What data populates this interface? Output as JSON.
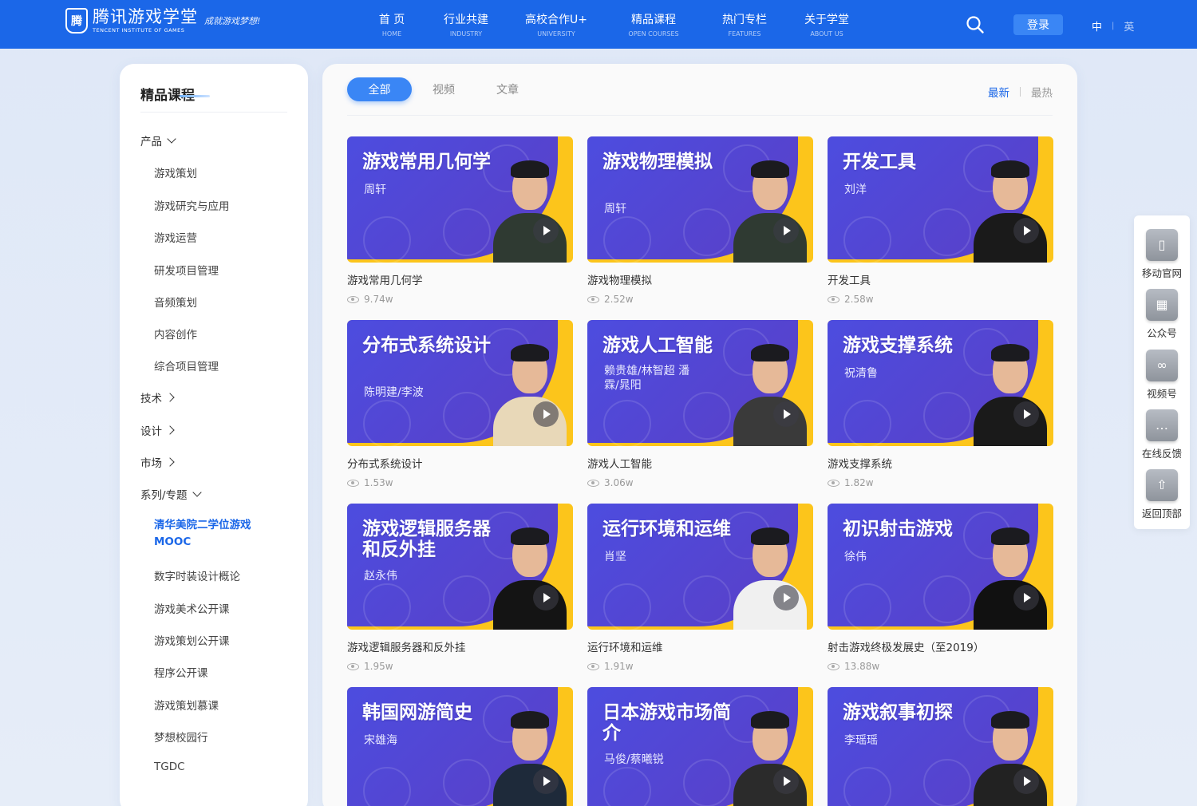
{
  "header": {
    "logo_mark": "腾",
    "logo_cn": "腾讯游戏学堂",
    "logo_en": "TENCENT INSTITUTE OF GAMES",
    "slogan": "成就游戏梦想!",
    "nav": [
      {
        "cn": "首 页",
        "en": "HOME"
      },
      {
        "cn": "行业共建",
        "en": "INDUSTRY"
      },
      {
        "cn": "高校合作U+",
        "en": "UNIVERSITY"
      },
      {
        "cn": "精品课程",
        "en": "OPEN COURSES"
      },
      {
        "cn": "热门专栏",
        "en": "FEATURES"
      },
      {
        "cn": "关于学堂",
        "en": "ABOUT US"
      }
    ],
    "login": "登录",
    "lang_zh": "中",
    "lang_sep": "|",
    "lang_en": "英"
  },
  "sidebar": {
    "title": "精品课程",
    "groups": [
      {
        "label": "产品",
        "expanded": true
      },
      {
        "label": "技术",
        "expanded": false
      },
      {
        "label": "设计",
        "expanded": false
      },
      {
        "label": "市场",
        "expanded": false
      },
      {
        "label": "系列/专题",
        "expanded": true
      }
    ],
    "product_items": [
      "游戏策划",
      "游戏研究与应用",
      "游戏运营",
      "研发项目管理",
      "音频策划",
      "内容创作",
      "综合项目管理"
    ],
    "series_items": [
      "清华美院二学位游戏MOOC",
      "数字时装设计概论",
      "游戏美术公开课",
      "游戏策划公开课",
      "程序公开课",
      "游戏策划慕课",
      "梦想校园行",
      "TGDC"
    ],
    "active_item": "清华美院二学位游戏MOOC"
  },
  "tabs": [
    "全部",
    "视频",
    "文章"
  ],
  "sort": {
    "newest": "最新",
    "hottest": "最热"
  },
  "courses": [
    {
      "thumb_title": "游戏常用几何学",
      "speaker": "周轩",
      "title": "游戏常用几何学",
      "views": "9.74w"
    },
    {
      "thumb_title": "游戏物理模拟",
      "speaker": "周轩",
      "title": "游戏物理模拟",
      "views": "2.52w"
    },
    {
      "thumb_title": "开发工具",
      "speaker": "刘洋",
      "title": "开发工具",
      "views": "2.58w"
    },
    {
      "thumb_title": "分布式系统设计",
      "speaker": "陈明建/李波",
      "title": "分布式系统设计",
      "views": "1.53w"
    },
    {
      "thumb_title": "游戏人工智能",
      "speaker": "赖贵雄/林智超 潘霖/晁阳",
      "title": "游戏人工智能",
      "views": "3.06w"
    },
    {
      "thumb_title": "游戏支撑系统",
      "speaker": "祝清鲁",
      "title": "游戏支撑系统",
      "views": "1.82w"
    },
    {
      "thumb_title": "游戏逻辑服务器和反外挂",
      "speaker": "赵永伟",
      "title": "游戏逻辑服务器和反外挂",
      "views": "1.95w"
    },
    {
      "thumb_title": "运行环境和运维",
      "speaker": "肖坚",
      "title": "运行环境和运维",
      "views": "1.91w"
    },
    {
      "thumb_title": "初识射击游戏",
      "speaker": "徐伟",
      "title": "射击游戏终极发展史（至2019）",
      "views": "13.88w"
    },
    {
      "thumb_title": "韩国网游简史",
      "speaker": "宋雄海",
      "title": "",
      "views": ""
    },
    {
      "thumb_title": "日本游戏市场简介",
      "speaker": "马俊/蔡曦锐",
      "title": "",
      "views": ""
    },
    {
      "thumb_title": "游戏叙事初探",
      "speaker": "李瑶瑶",
      "title": "",
      "views": ""
    }
  ],
  "float_tools": [
    {
      "icon": "mobile-icon",
      "label": "移动官网"
    },
    {
      "icon": "qrcode-icon",
      "label": "公众号"
    },
    {
      "icon": "video-channel-icon",
      "label": "视频号"
    },
    {
      "icon": "chat-icon",
      "label": "在线反馈"
    },
    {
      "icon": "back-to-top-icon",
      "label": "返回顶部"
    }
  ],
  "colors": {
    "primary": "#1b67e8",
    "accent": "#3a86f5",
    "thumb_purple": "#4c4de0",
    "thumb_yellow": "#fcc51b"
  }
}
